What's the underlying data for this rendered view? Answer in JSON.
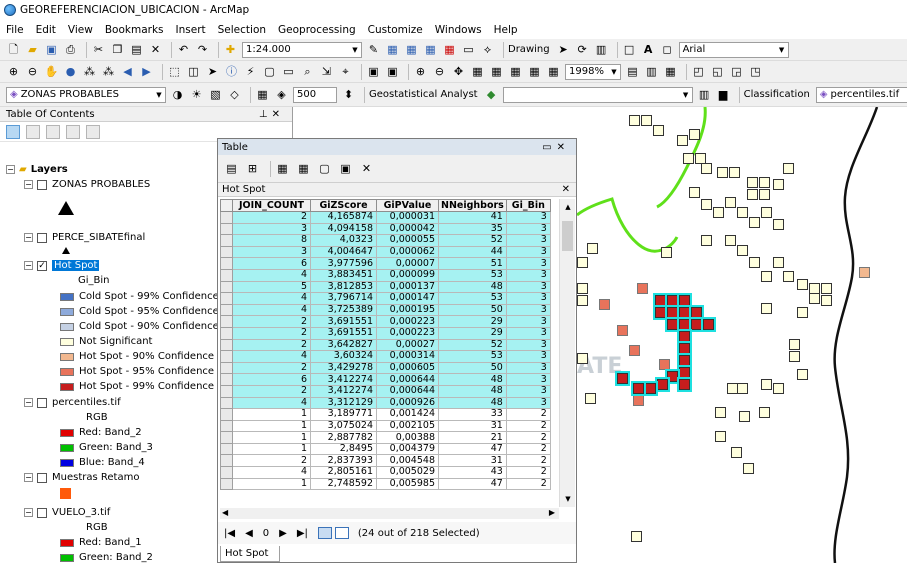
{
  "window": {
    "title": "GEOREFERENCIACION_UBICACION - ArcMap"
  },
  "menu": [
    "File",
    "Edit",
    "View",
    "Bookmarks",
    "Insert",
    "Selection",
    "Geoprocessing",
    "Customize",
    "Windows",
    "Help"
  ],
  "toolbar1": {
    "scale": "1:24.000",
    "drawing_label": "Drawing",
    "font_value": "Arial"
  },
  "toolbar2": {
    "zoom_value": "1998%"
  },
  "toolbar3": {
    "layer_value": "ZONAS PROBABLES",
    "number_value": "500",
    "geostat_label": "Geostatistical Analyst",
    "classification_label": "Classification",
    "raster_value": "percentiles.tif"
  },
  "toc": {
    "title": "Table Of Contents",
    "root": "Layers",
    "layers": [
      {
        "name": "ZONAS PROBABLES"
      },
      {
        "name": "PERCE_SIBATEfinal"
      },
      {
        "name": "Hot Spot",
        "field": "Gi_Bin",
        "legend": [
          {
            "label": "Cold Spot - 99% Confidence",
            "color": "#4472c4"
          },
          {
            "label": "Cold Spot - 95% Confidence",
            "color": "#8eaadb"
          },
          {
            "label": "Cold Spot - 90% Confidence",
            "color": "#c5d1e4"
          },
          {
            "label": "Not Significant",
            "color": "#ffffde"
          },
          {
            "label": "Hot Spot - 90% Confidence",
            "color": "#f2b88f"
          },
          {
            "label": "Hot Spot - 95% Confidence",
            "color": "#e8735b"
          },
          {
            "label": "Hot Spot - 99% Confidence",
            "color": "#c61d1d"
          }
        ]
      },
      {
        "name": "percentiles.tif",
        "rgb": "RGB",
        "bands": [
          {
            "label": "Red:",
            "band": "Band_2",
            "color": "#e00000"
          },
          {
            "label": "Green:",
            "band": "Band_3",
            "color": "#00c000"
          },
          {
            "label": "Blue:",
            "band": "Band_4",
            "color": "#0000e0"
          }
        ]
      },
      {
        "name": "Muestras Retamo",
        "color": "#ff5a0a"
      },
      {
        "name": "VUELO_3.tif",
        "rgb": "RGB",
        "bands": [
          {
            "label": "Red:",
            "band": "Band_1",
            "color": "#e00000"
          },
          {
            "label": "Green:",
            "band": "Band_2",
            "color": "#00c000"
          }
        ]
      }
    ]
  },
  "table": {
    "window_title": "Table",
    "tab_title": "Hot Spot",
    "bottom_tab": "Hot Spot",
    "columns": [
      "JOIN_COUNT",
      "GiZScore",
      "GiPValue",
      "NNeighbors",
      "Gi_Bin"
    ],
    "rows": [
      [
        "2",
        "4,165874",
        "0,000031",
        "41",
        "3"
      ],
      [
        "3",
        "4,094158",
        "0,000042",
        "35",
        "3"
      ],
      [
        "8",
        "4,0323",
        "0,000055",
        "52",
        "3"
      ],
      [
        "3",
        "4,004647",
        "0,000062",
        "44",
        "3"
      ],
      [
        "6",
        "3,977596",
        "0,00007",
        "51",
        "3"
      ],
      [
        "4",
        "3,883451",
        "0,000099",
        "53",
        "3"
      ],
      [
        "5",
        "3,812853",
        "0,000137",
        "48",
        "3"
      ],
      [
        "4",
        "3,796714",
        "0,000147",
        "53",
        "3"
      ],
      [
        "4",
        "3,725389",
        "0,000195",
        "50",
        "3"
      ],
      [
        "2",
        "3,691551",
        "0,000223",
        "29",
        "3"
      ],
      [
        "2",
        "3,691551",
        "0,000223",
        "29",
        "3"
      ],
      [
        "2",
        "3,642827",
        "0,00027",
        "52",
        "3"
      ],
      [
        "4",
        "3,60324",
        "0,000314",
        "53",
        "3"
      ],
      [
        "2",
        "3,429278",
        "0,000605",
        "50",
        "3"
      ],
      [
        "6",
        "3,412274",
        "0,000644",
        "48",
        "3"
      ],
      [
        "2",
        "3,412274",
        "0,000644",
        "48",
        "3"
      ],
      [
        "4",
        "3,312129",
        "0,000926",
        "48",
        "3"
      ],
      [
        "1",
        "3,189771",
        "0,001424",
        "33",
        "2"
      ],
      [
        "1",
        "3,075024",
        "0,002105",
        "31",
        "2"
      ],
      [
        "1",
        "2,887782",
        "0,00388",
        "21",
        "2"
      ],
      [
        "1",
        "2,8495",
        "0,004379",
        "47",
        "2"
      ],
      [
        "2",
        "2,837393",
        "0,004548",
        "31",
        "2"
      ],
      [
        "4",
        "2,805161",
        "0,005029",
        "43",
        "2"
      ],
      [
        "1",
        "2,748592",
        "0,005985",
        "47",
        "2"
      ]
    ],
    "selected_rows": 17,
    "record_value": "0",
    "selection_status": "(24 out of 218 Selected)"
  },
  "map": {
    "label": "ATE"
  }
}
